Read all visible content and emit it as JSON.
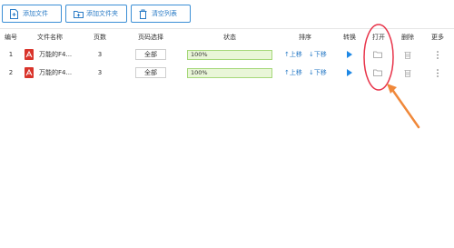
{
  "toolbar": {
    "add_file": "添加文件",
    "add_folder": "添加文件夹",
    "clear_list": "清空列表"
  },
  "headers": {
    "index": "编号",
    "name": "文件名称",
    "pages": "页数",
    "page_select": "页码选择",
    "status": "状态",
    "sort": "排序",
    "convert": "转换",
    "open": "打开",
    "delete": "删除",
    "more": "更多"
  },
  "rows": [
    {
      "index": "1",
      "name": "万能的F4...",
      "pages": "3",
      "page_select": "全部",
      "status": "100%",
      "up": "↑上移",
      "down": "↓下移"
    },
    {
      "index": "2",
      "name": "万能的F4...",
      "pages": "3",
      "page_select": "全部",
      "status": "100%",
      "up": "↑上移",
      "down": "↓下移"
    }
  ],
  "colors": {
    "accent": "#2a7bc6",
    "play": "#1e88e5",
    "progress_border": "#a6d87a",
    "progress_fill": "#e9f6d8",
    "annotation": "#e8344a",
    "arrow": "#f0883a"
  }
}
